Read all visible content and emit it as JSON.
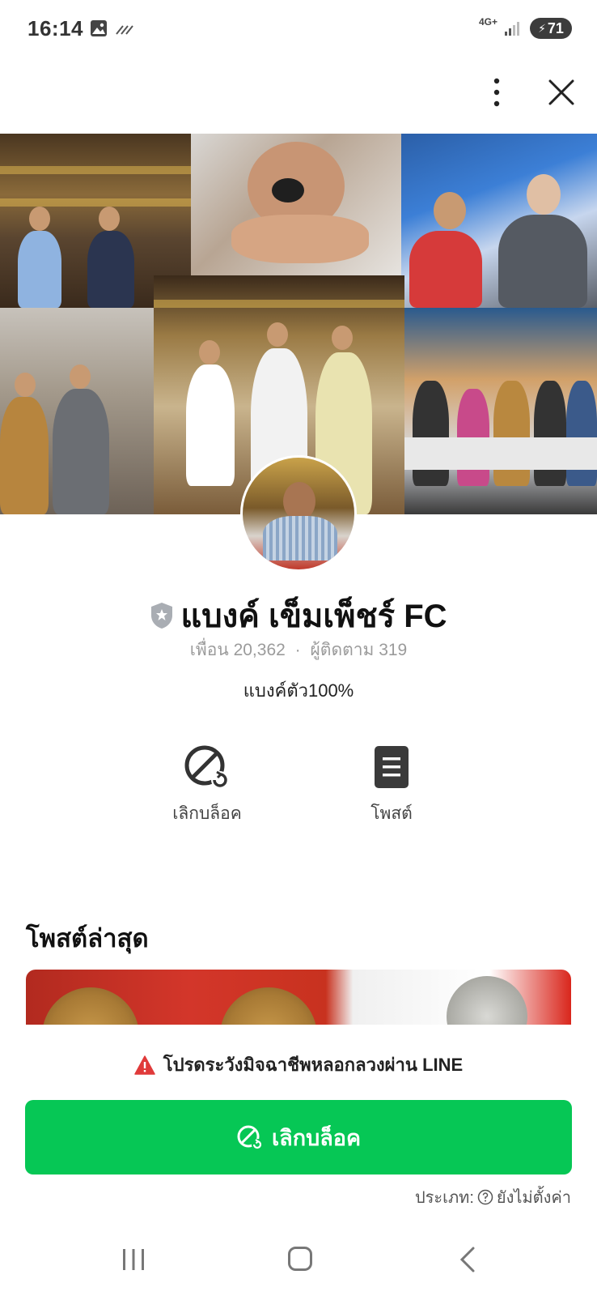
{
  "status_bar": {
    "time": "16:14",
    "network": "4G+",
    "battery": "71",
    "icons": [
      "gallery-icon",
      "sync-icon",
      "signal-icon",
      "battery-icon"
    ]
  },
  "top_bar": {
    "icons": [
      "more-vertical-icon",
      "close-icon"
    ]
  },
  "profile": {
    "name": "แบงค์ เข็มเพ็ชร์ FC",
    "friends_label": "เพื่อน",
    "friends_count": "20,362",
    "separator": "·",
    "followers_label": "ผู้ติดตาม",
    "followers_count": "319",
    "status_message": "แบงค์ตัว100%"
  },
  "actions": {
    "unblock_label": "เลิกบล็อค",
    "post_label": "โพสต์"
  },
  "latest_posts": {
    "title": "โพสต์ล่าสุด"
  },
  "bottom": {
    "warning": "โปรดระวังมิจฉาชีพหลอกลวงผ่าน LINE",
    "unblock_button": "เลิกบล็อค",
    "type_label": "ประเภท:",
    "type_value": "ยังไม่ตั้งค่า"
  },
  "colors": {
    "accent_green": "#06c755",
    "warning_red": "#e03a3a",
    "muted_text": "#9b9b9b"
  }
}
